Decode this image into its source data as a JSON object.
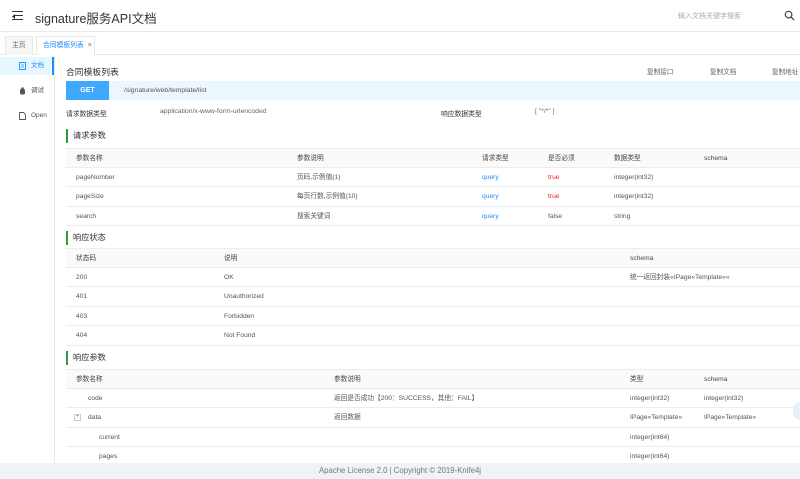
{
  "header": {
    "title": "signature服务API文档",
    "search_placeholder": "输入文档关键字搜索"
  },
  "tabs": [
    {
      "label": "主页"
    },
    {
      "label": "合同模板列表",
      "close": "×"
    }
  ],
  "sidebar": {
    "items": [
      {
        "label": "文档",
        "icon": "document-icon"
      },
      {
        "label": "调试",
        "icon": "debug-icon"
      },
      {
        "label": "Open",
        "icon": "file-icon"
      }
    ]
  },
  "doc": {
    "title": "合同模板列表",
    "copy_links": [
      "复制接口",
      "复制文档",
      "复制地址"
    ],
    "method": "GET",
    "path": "/signature/web/template/list",
    "request_type_label": "请求数据类型",
    "request_type_value": "application/x-www-form-urlencoded",
    "response_type_label": "响应数据类型",
    "response_type_value": "[ \"*/*\" ]"
  },
  "request_params": {
    "title": "请求参数",
    "headers": [
      "参数名称",
      "参数说明",
      "请求类型",
      "是否必须",
      "数据类型",
      "schema"
    ],
    "rows": [
      {
        "name": "pageNumber",
        "desc": "页码,示例值(1)",
        "in": "query",
        "required": "true",
        "type": "integer(int32)",
        "schema": ""
      },
      {
        "name": "pageSize",
        "desc": "每页行数,示例值(10)",
        "in": "query",
        "required": "true",
        "type": "integer(int32)",
        "schema": ""
      },
      {
        "name": "search",
        "desc": "搜索关键词",
        "in": "query",
        "required": "false",
        "type": "string",
        "schema": ""
      }
    ]
  },
  "response_status": {
    "title": "响应状态",
    "headers": [
      "状态码",
      "说明",
      "schema"
    ],
    "rows": [
      {
        "code": "200",
        "desc": "OK",
        "schema": "统一返回封装«IPage«Template»»"
      },
      {
        "code": "401",
        "desc": "Unauthorized",
        "schema": ""
      },
      {
        "code": "403",
        "desc": "Forbidden",
        "schema": ""
      },
      {
        "code": "404",
        "desc": "Not Found",
        "schema": ""
      }
    ]
  },
  "response_params": {
    "title": "响应参数",
    "headers": [
      "参数名称",
      "参数说明",
      "类型",
      "schema"
    ],
    "rows": [
      {
        "name": "code",
        "desc": "返回是否成功【200：SUCCESS，其他：FAIL】",
        "type": "integer(int32)",
        "schema": "integer(int32)"
      },
      {
        "name": "data",
        "desc": "返回数据",
        "type": "IPage«Template»",
        "schema": "IPage«Template»",
        "expander": "+"
      },
      {
        "name": "current",
        "desc": "",
        "type": "integer(int64)",
        "schema": ""
      },
      {
        "name": "pages",
        "desc": "",
        "type": "integer(int64)",
        "schema": ""
      }
    ]
  },
  "footer": {
    "text": "Apache License 2.0 | Copyright © 2019-Knife4j"
  }
}
